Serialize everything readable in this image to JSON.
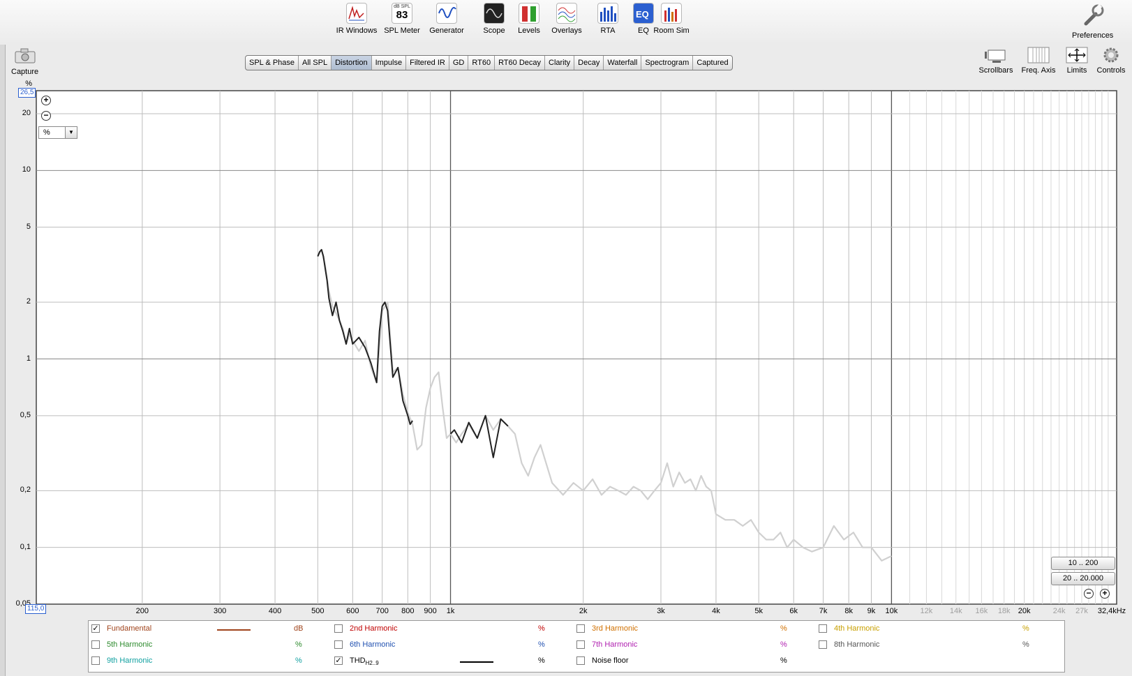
{
  "toolbar": {
    "tools": [
      {
        "label": "IR Windows",
        "icon": "ir-windows-icon"
      },
      {
        "label": "SPL Meter",
        "icon": "spl-meter-icon",
        "top_text": "dB SPL",
        "value": "83"
      },
      {
        "label": "Generator",
        "icon": "generator-icon"
      },
      {
        "label": "Scope",
        "icon": "scope-icon"
      },
      {
        "label": "Levels",
        "icon": "levels-icon"
      },
      {
        "label": "Overlays",
        "icon": "overlays-icon"
      },
      {
        "label": "RTA",
        "icon": "rta-icon"
      },
      {
        "label": "EQ",
        "icon": "eq-icon"
      },
      {
        "label": "Room Sim",
        "icon": "room-sim-icon"
      }
    ],
    "preferences_label": "Preferences",
    "capture_label": "Capture"
  },
  "tabs": [
    "SPL & Phase",
    "All SPL",
    "Distortion",
    "Impulse",
    "Filtered IR",
    "GD",
    "RT60",
    "RT60 Decay",
    "Clarity",
    "Decay",
    "Waterfall",
    "Spectrogram",
    "Captured"
  ],
  "active_tab": "Distortion",
  "right_tools": [
    {
      "label": "Scrollbars",
      "icon": "scrollbars-icon"
    },
    {
      "label": "Freq. Axis",
      "icon": "freq-axis-icon"
    },
    {
      "label": "Limits",
      "icon": "limits-icon"
    },
    {
      "label": "Controls",
      "icon": "gear-icon"
    }
  ],
  "plot": {
    "y_unit": "%",
    "y_max_label": "26,5",
    "x_min_label": "115,0",
    "unit_select_value": "%",
    "range_buttons": [
      "10 .. 200",
      "20 .. 20.000"
    ]
  },
  "chart_data": {
    "type": "line",
    "title": "",
    "xlabel": "",
    "ylabel": "%",
    "x_scale": "log",
    "y_scale": "log",
    "xlim": [
      115,
      32400
    ],
    "ylim": [
      0.05,
      26.5
    ],
    "x_ticks": [
      "200",
      "300",
      "400",
      "500",
      "600",
      "700",
      "800",
      "900",
      "1k",
      "2k",
      "3k",
      "4k",
      "5k",
      "6k",
      "7k",
      "8k",
      "9k",
      "10k",
      "12k",
      "14k",
      "16k",
      "18k",
      "20k",
      "24k",
      "27k",
      "32,4kHz"
    ],
    "y_ticks": [
      "20",
      "10",
      "5",
      "2",
      "1",
      "0,5",
      "0,2",
      "0,1",
      "0,05"
    ],
    "grid": true,
    "series": [
      {
        "name": "THD",
        "color": "#d0d0d0",
        "x": [
          500,
          510,
          520,
          530,
          540,
          550,
          560,
          570,
          580,
          590,
          600,
          620,
          640,
          660,
          680,
          700,
          720,
          740,
          760,
          780,
          800,
          820,
          840,
          860,
          880,
          900,
          920,
          940,
          960,
          980,
          1000,
          1030,
          1060,
          1100,
          1150,
          1200,
          1250,
          1300,
          1350,
          1400,
          1450,
          1500,
          1550,
          1600,
          1700,
          1800,
          1900,
          2000,
          2100,
          2200,
          2300,
          2400,
          2500,
          2600,
          2700,
          2800,
          2900,
          3000,
          3100,
          3200,
          3300,
          3400,
          3500,
          3600,
          3700,
          3800,
          3900,
          4000,
          4200,
          4400,
          4600,
          4800,
          5000,
          5200,
          5400,
          5600,
          5800,
          6000,
          6300,
          6600,
          7000,
          7400,
          7800,
          8200,
          8600,
          9000,
          9500,
          10000
        ],
        "values": [
          3.5,
          3.8,
          3.1,
          2.3,
          1.9,
          1.75,
          1.6,
          1.45,
          1.2,
          1.35,
          1.25,
          1.1,
          1.25,
          0.9,
          0.75,
          1.8,
          2.0,
          0.85,
          0.9,
          0.65,
          0.52,
          0.45,
          0.33,
          0.35,
          0.55,
          0.7,
          0.8,
          0.85,
          0.55,
          0.38,
          0.4,
          0.36,
          0.4,
          0.45,
          0.38,
          0.5,
          0.42,
          0.48,
          0.44,
          0.4,
          0.28,
          0.24,
          0.3,
          0.35,
          0.22,
          0.19,
          0.22,
          0.2,
          0.23,
          0.19,
          0.21,
          0.2,
          0.19,
          0.21,
          0.2,
          0.18,
          0.2,
          0.22,
          0.28,
          0.21,
          0.25,
          0.22,
          0.23,
          0.2,
          0.24,
          0.21,
          0.2,
          0.15,
          0.14,
          0.14,
          0.13,
          0.14,
          0.12,
          0.11,
          0.11,
          0.12,
          0.1,
          0.11,
          0.1,
          0.095,
          0.1,
          0.13,
          0.11,
          0.12,
          0.1,
          0.1,
          0.085,
          0.09
        ]
      },
      {
        "name": "THD (valid region)",
        "color": "#222222",
        "x": [
          500,
          505,
          510,
          515,
          520,
          525,
          530,
          540,
          550,
          560,
          570,
          580,
          590,
          600,
          620,
          640,
          660,
          680,
          690,
          700,
          710,
          720,
          740,
          760,
          780,
          800,
          810,
          820,
          1000,
          1020,
          1060,
          1100,
          1150,
          1200,
          1250,
          1300,
          1350
        ],
        "values": [
          3.5,
          3.7,
          3.8,
          3.5,
          3.0,
          2.6,
          2.1,
          1.7,
          2.0,
          1.6,
          1.4,
          1.2,
          1.45,
          1.2,
          1.3,
          1.15,
          0.95,
          0.75,
          1.4,
          1.9,
          2.0,
          1.8,
          0.8,
          0.9,
          0.6,
          0.5,
          0.45,
          0.47,
          0.4,
          0.42,
          0.36,
          0.46,
          0.38,
          0.5,
          0.3,
          0.48,
          0.44
        ]
      }
    ]
  },
  "legend": [
    {
      "label": "Fundamental",
      "checked": true,
      "unit": "dB",
      "color": "#a0441c",
      "line_color": "#a0441c"
    },
    {
      "label": "2nd Harmonic",
      "checked": false,
      "unit": "%",
      "color": "#c00000"
    },
    {
      "label": "3rd Harmonic",
      "checked": false,
      "unit": "%",
      "color": "#d07000"
    },
    {
      "label": "4th Harmonic",
      "checked": false,
      "unit": "%",
      "color": "#c8a000"
    },
    {
      "label": "5th Harmonic",
      "checked": false,
      "unit": "%",
      "color": "#2c8a2c"
    },
    {
      "label": "6th Harmonic",
      "checked": false,
      "unit": "%",
      "color": "#2050b0"
    },
    {
      "label": "7th Harmonic",
      "checked": false,
      "unit": "%",
      "color": "#b020b0"
    },
    {
      "label": "8th Harmonic",
      "checked": false,
      "unit": "%",
      "color": "#555555"
    },
    {
      "label": "9th Harmonic",
      "checked": false,
      "unit": "%",
      "color": "#10a0a0"
    },
    {
      "label": "THD",
      "sub": "H2..9",
      "checked": true,
      "unit": "%",
      "color": "#000000",
      "line_color": "#000000"
    },
    {
      "label": "Noise floor",
      "checked": false,
      "unit": "%",
      "color": "#000000"
    }
  ]
}
